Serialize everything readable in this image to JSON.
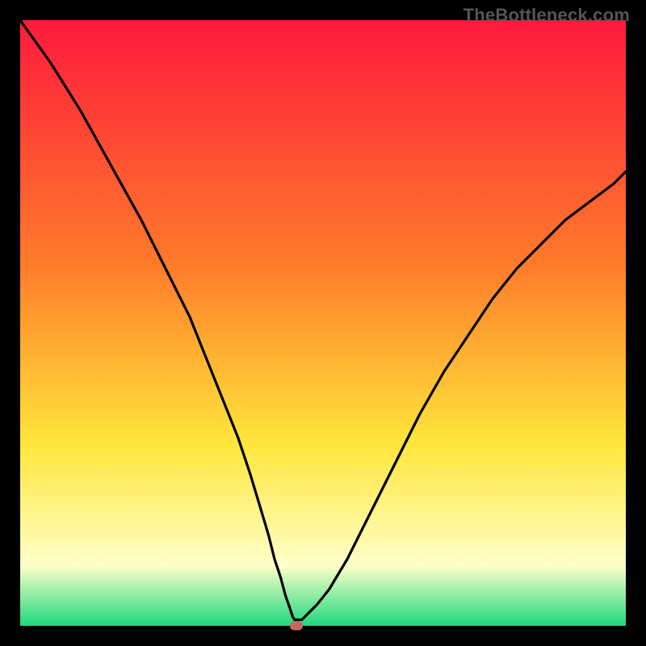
{
  "watermark": "TheBottleneck.com",
  "colors": {
    "gradient_top": "#ff1a3d",
    "gradient_mid1": "#ff7a2a",
    "gradient_mid2": "#ffe63a",
    "gradient_pale": "#ffffc8",
    "gradient_bottom": "#1ed97f",
    "curve": "#000000",
    "marker": "#c9655d",
    "frame": "#000000"
  },
  "chart_data": {
    "type": "line",
    "title": "",
    "xlabel": "",
    "ylabel": "",
    "xlim": [
      0,
      100
    ],
    "ylim": [
      0,
      100
    ],
    "x": [
      0,
      5,
      10,
      15,
      20,
      22,
      25,
      28,
      30,
      32,
      34,
      36,
      38,
      39.5,
      41,
      42,
      43,
      43.8,
      44.5,
      45,
      45.3,
      45.6,
      46,
      46.5,
      47.5,
      49,
      51,
      54,
      58,
      62,
      66,
      70,
      74,
      78,
      82,
      86,
      90,
      94,
      98,
      100
    ],
    "values": [
      100,
      93,
      85,
      76,
      67,
      63,
      57,
      51,
      46,
      41,
      36,
      31,
      25,
      20,
      15,
      11,
      8,
      5,
      3,
      1.5,
      1,
      1,
      1,
      1,
      2,
      3.5,
      6,
      11,
      19,
      27,
      35,
      42,
      48,
      54,
      59,
      63,
      67,
      70,
      73,
      75
    ],
    "annotations": [
      {
        "name": "minimum-marker",
        "x": 45.6,
        "y": 0
      }
    ]
  }
}
